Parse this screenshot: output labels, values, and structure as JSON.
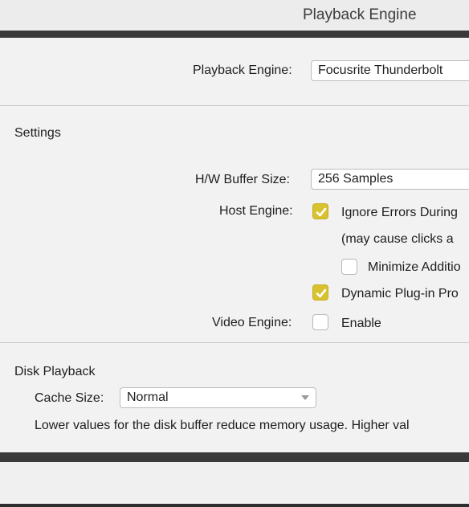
{
  "window": {
    "title": "Playback Engine"
  },
  "playback_engine": {
    "label": "Playback Engine:",
    "value": "Focusrite Thunderbolt"
  },
  "settings": {
    "heading": "Settings",
    "buffer_label": "H/W Buffer Size:",
    "buffer_value": "256 Samples",
    "host_engine_label": "Host Engine:",
    "ignore_errors_label": "Ignore Errors During",
    "ignore_errors_checked": true,
    "ignore_errors_note": "(may cause clicks a",
    "minimize_label": "Minimize Additio",
    "minimize_checked": false,
    "dynamic_plugin_label": "Dynamic Plug-in Pro",
    "dynamic_plugin_checked": true,
    "video_engine_label": "Video Engine:",
    "video_enable_label": "Enable",
    "video_enable_checked": false
  },
  "disk_playback": {
    "heading": "Disk Playback",
    "cache_label": "Cache Size:",
    "cache_value": "Normal",
    "note": "Lower values for the disk buffer reduce memory usage.  Higher val"
  },
  "colors": {
    "checkbox_checked": "#d9c230",
    "dark_bar": "#3a3a3a"
  }
}
